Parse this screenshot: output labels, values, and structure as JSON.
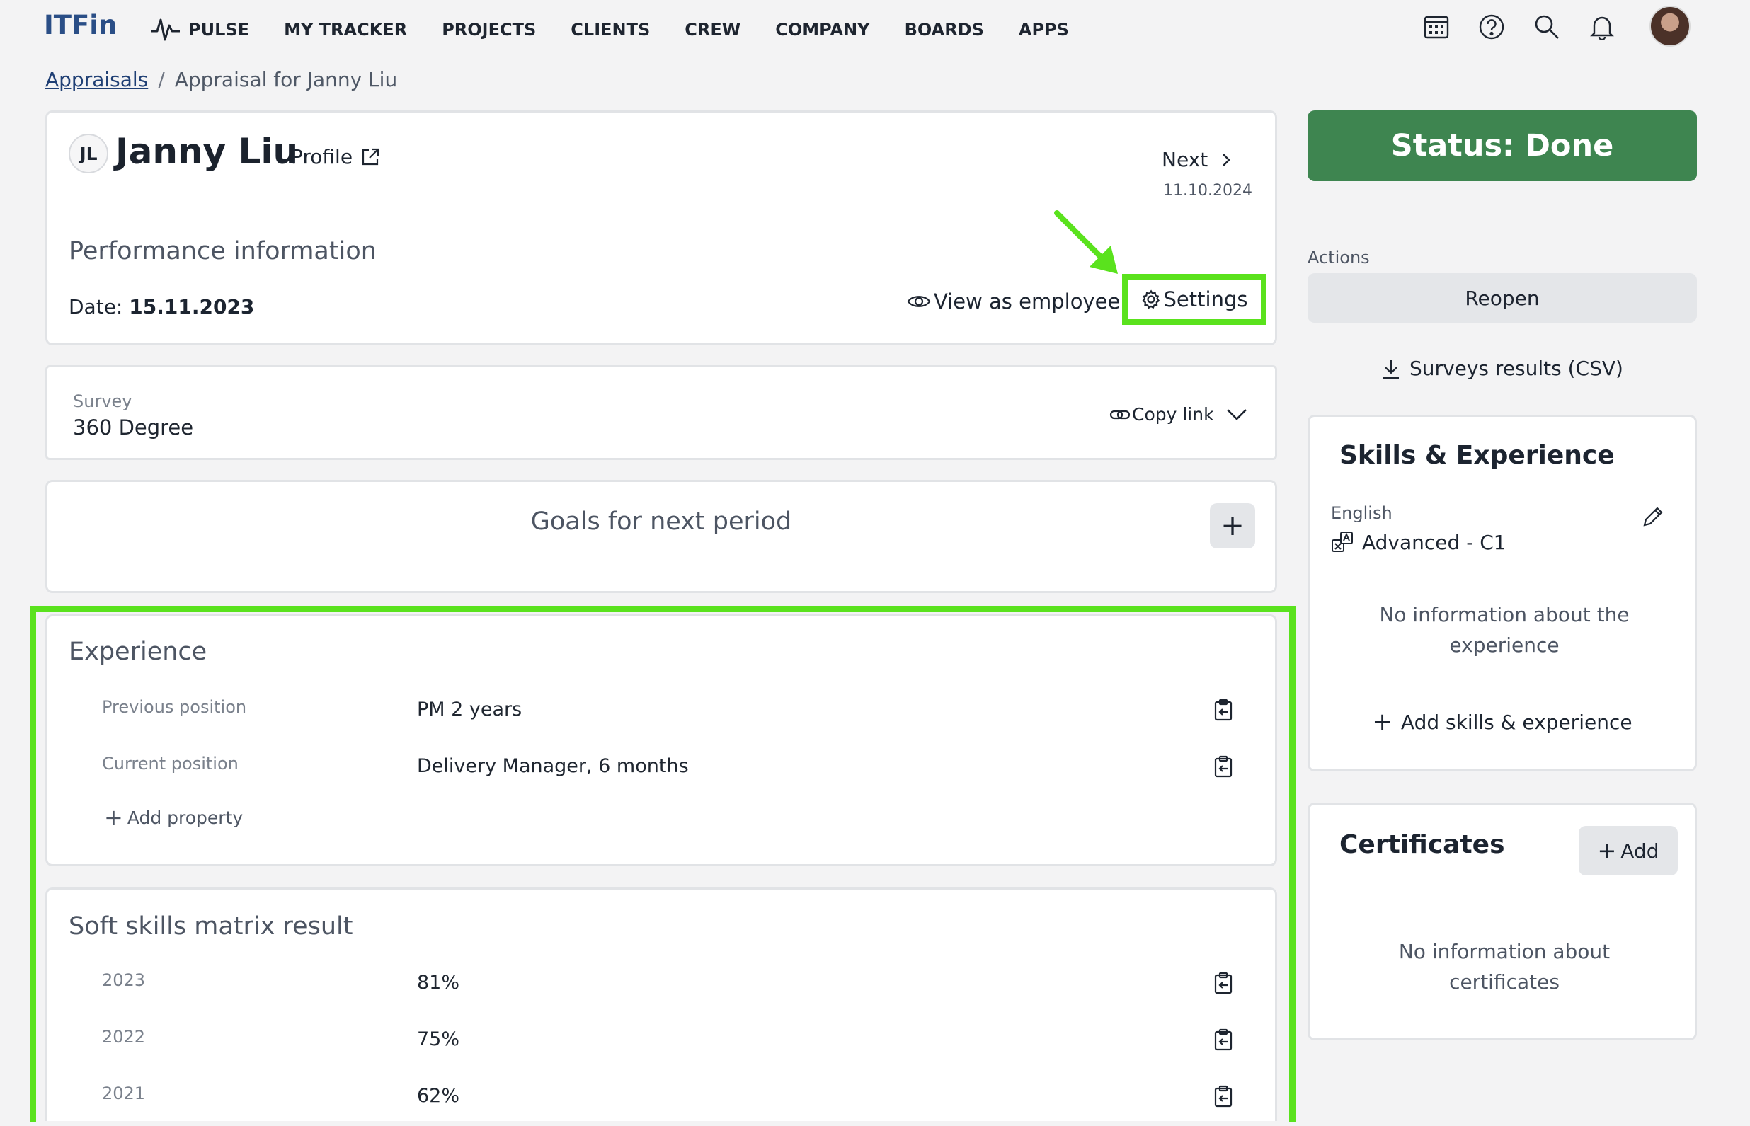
{
  "header": {
    "logo": "ITFin",
    "nav": [
      {
        "label": "PULSE",
        "icon": "pulse-icon"
      },
      {
        "label": "MY TRACKER"
      },
      {
        "label": "PROJECTS"
      },
      {
        "label": "CLIENTS"
      },
      {
        "label": "CREW"
      },
      {
        "label": "COMPANY"
      },
      {
        "label": "BOARDS"
      },
      {
        "label": "APPS"
      }
    ],
    "icons": [
      "calendar-icon",
      "help-icon",
      "search-icon",
      "bell-icon"
    ]
  },
  "breadcrumb": {
    "parent": "Appraisals",
    "separator": "/",
    "current": "Appraisal for Janny Liu"
  },
  "employee": {
    "initials": "JL",
    "name": "Janny Liu",
    "profile_label": "Profile",
    "next_label": "Next",
    "next_date": "11.10.2024",
    "section_title": "Performance information",
    "date_label": "Date:",
    "date_value": "15.11.2023",
    "view_as_employee": "View as employee",
    "settings": "Settings"
  },
  "survey": {
    "label": "Survey",
    "value": "360 Degree",
    "copy_link": "Copy link"
  },
  "goals": {
    "title": "Goals for next period",
    "add": "+"
  },
  "experience": {
    "title": "Experience",
    "rows": [
      {
        "label": "Previous position",
        "value": "PM 2 years"
      },
      {
        "label": "Current position",
        "value": "Delivery Manager, 6 months"
      }
    ],
    "add_property": "Add property"
  },
  "soft_skills": {
    "title": "Soft skills matrix result",
    "rows": [
      {
        "label": "2023",
        "value": "81%"
      },
      {
        "label": "2022",
        "value": "75%"
      },
      {
        "label": "2021",
        "value": "62%"
      }
    ]
  },
  "sidebar": {
    "status": "Status: Done",
    "actions_label": "Actions",
    "reopen": "Reopen",
    "surveys_csv": "Surveys results (CSV)",
    "skills": {
      "title": "Skills & Experience",
      "lang_label": "English",
      "lang_value": "Advanced - C1",
      "empty": "No information about the experience",
      "add": "Add skills & experience"
    },
    "certificates": {
      "title": "Certificates",
      "add": "Add",
      "empty": "No information about certificates"
    }
  },
  "colors": {
    "accent_green": "#3e8550",
    "highlight": "#5ae21d",
    "logo_blue": "#2a4e86"
  }
}
